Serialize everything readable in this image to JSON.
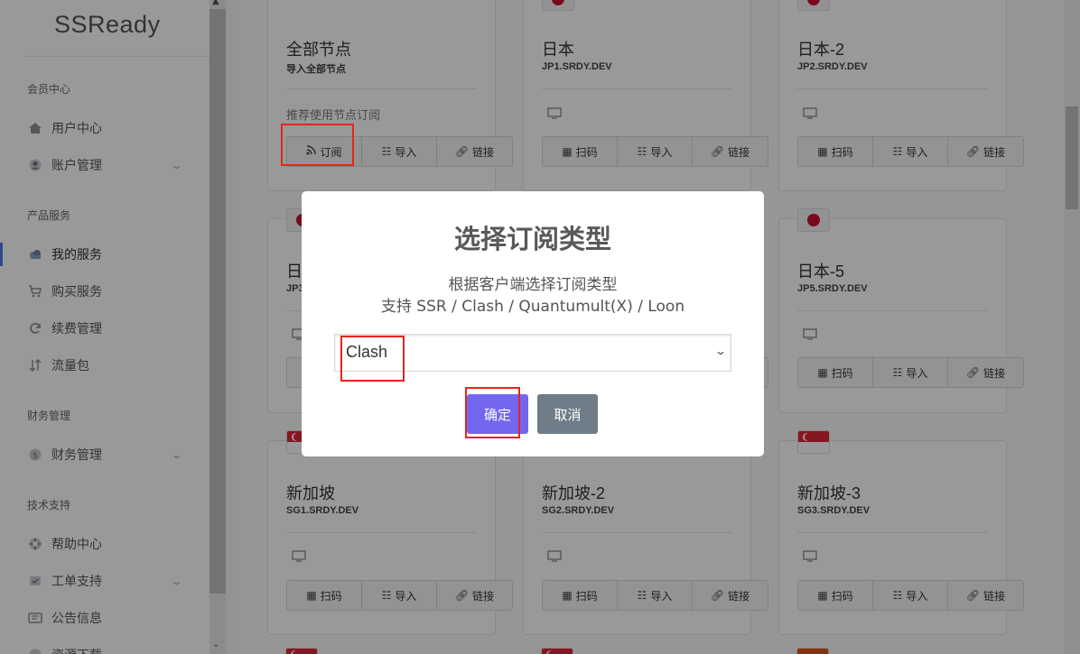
{
  "brand": "SSReady",
  "sidebar": {
    "sections": [
      {
        "title": "会员中心",
        "items": [
          {
            "label": "用户中心",
            "icon": "home-icon"
          },
          {
            "label": "账户管理",
            "icon": "user-icon",
            "chevron": true
          }
        ]
      },
      {
        "title": "产品服务",
        "items": [
          {
            "label": "我的服务",
            "icon": "cloud-icon",
            "active": true
          },
          {
            "label": "购买服务",
            "icon": "cart-icon"
          },
          {
            "label": "续费管理",
            "icon": "refresh-icon"
          },
          {
            "label": "流量包",
            "icon": "sort-icon"
          }
        ]
      },
      {
        "title": "财务管理",
        "items": [
          {
            "label": "财务管理",
            "icon": "coin-icon",
            "chevron": true
          }
        ]
      },
      {
        "title": "技术支持",
        "items": [
          {
            "label": "帮助中心",
            "icon": "lifebuoy-icon"
          },
          {
            "label": "工单支持",
            "icon": "ticket-icon",
            "chevron": true
          },
          {
            "label": "公告信息",
            "icon": "bullhorn-icon"
          },
          {
            "label": "资源下载",
            "icon": "download-icon"
          }
        ]
      }
    ]
  },
  "buttons": {
    "qr": "扫码",
    "import": "导入",
    "link": "链接",
    "subscribe": "订阅"
  },
  "nodes": {
    "all": {
      "name": "全部节点",
      "host": "导入全部节点",
      "hint": "推荐使用节点订阅"
    },
    "jp1": {
      "name": "日本",
      "host": "JP1.SRDY.DEV"
    },
    "jp2": {
      "name": "日本-2",
      "host": "JP2.SRDY.DEV"
    },
    "jp3": {
      "name": "日",
      "host": "JP3"
    },
    "jp5": {
      "name": "日本-5",
      "host": "JP5.SRDY.DEV"
    },
    "sg1": {
      "name": "新加坡",
      "host": "SG1.SRDY.DEV"
    },
    "sg2": {
      "name": "新加坡-2",
      "host": "SG2.SRDY.DEV"
    },
    "sg3": {
      "name": "新加坡-3",
      "host": "SG3.SRDY.DEV"
    }
  },
  "modal": {
    "title": "选择订阅类型",
    "line1": "根据客户端选择订阅类型",
    "line2": "支持 SSR / Clash / Quantumult(X) / Loon",
    "selected": "Clash",
    "ok": "确定",
    "cancel": "取消"
  },
  "colors": {
    "primary": "#7367f0",
    "secondary": "#6e7d88",
    "highlight": "#e8231c",
    "active": "#4b7bec"
  }
}
